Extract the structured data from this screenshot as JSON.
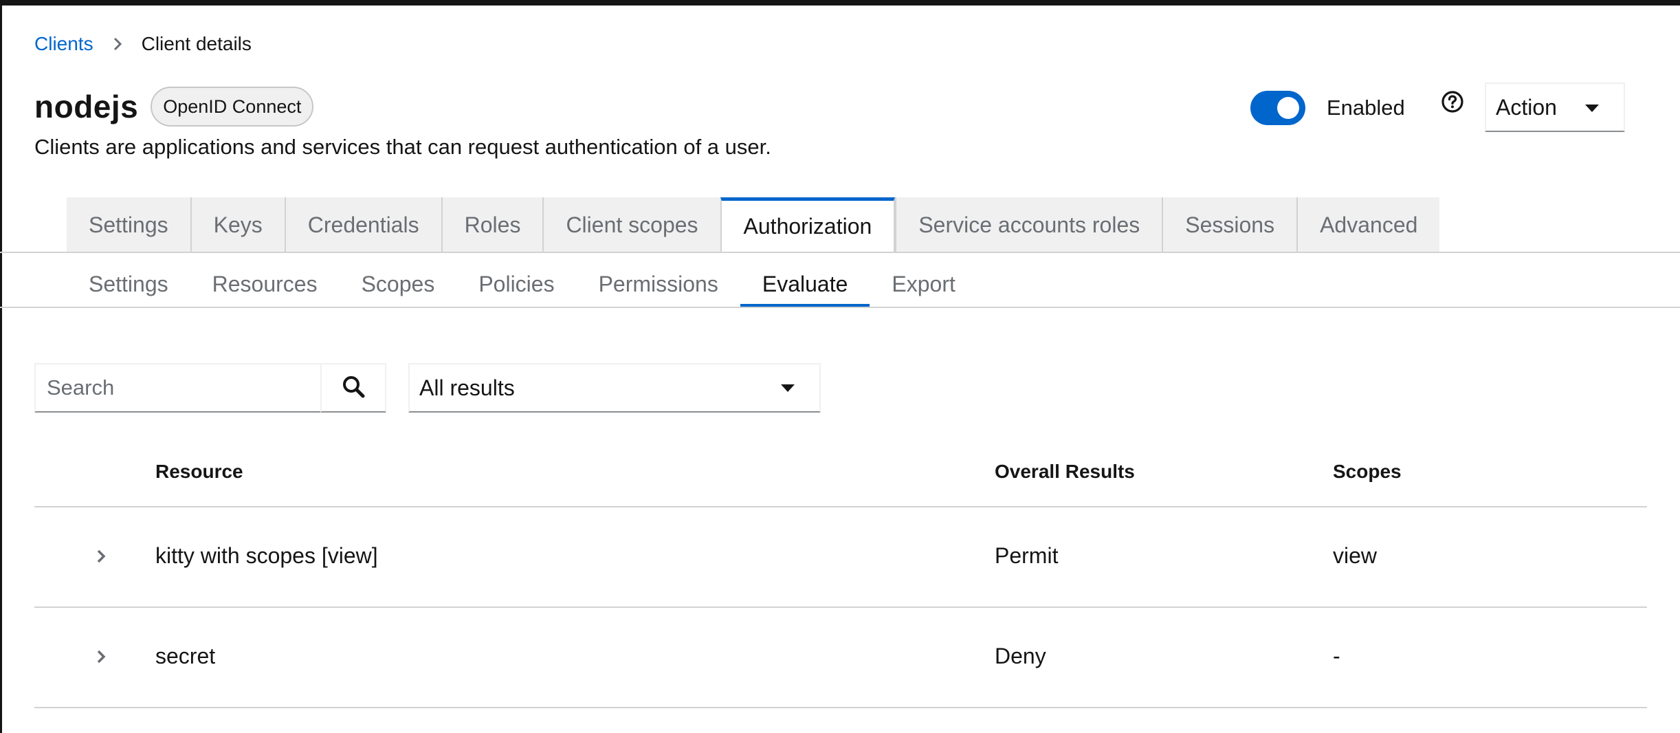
{
  "breadcrumb": {
    "parent": "Clients",
    "current": "Client details"
  },
  "header": {
    "title": "nodejs",
    "badge": "OpenID Connect",
    "subtitle": "Clients are applications and services that can request authentication of a user.",
    "enabled_label": "Enabled",
    "enabled": true,
    "action_label": "Action"
  },
  "main_tabs": [
    {
      "label": "Settings",
      "active": false
    },
    {
      "label": "Keys",
      "active": false
    },
    {
      "label": "Credentials",
      "active": false
    },
    {
      "label": "Roles",
      "active": false
    },
    {
      "label": "Client scopes",
      "active": false
    },
    {
      "label": "Authorization",
      "active": true
    },
    {
      "label": "Service accounts roles",
      "active": false
    },
    {
      "label": "Sessions",
      "active": false
    },
    {
      "label": "Advanced",
      "active": false
    }
  ],
  "sub_tabs": [
    {
      "label": "Settings",
      "active": false
    },
    {
      "label": "Resources",
      "active": false
    },
    {
      "label": "Scopes",
      "active": false
    },
    {
      "label": "Policies",
      "active": false
    },
    {
      "label": "Permissions",
      "active": false
    },
    {
      "label": "Evaluate",
      "active": true
    },
    {
      "label": "Export",
      "active": false
    }
  ],
  "toolbar": {
    "search_placeholder": "Search",
    "search_value": "",
    "filter_value": "All results"
  },
  "table": {
    "columns": {
      "resource": "Resource",
      "result": "Overall Results",
      "scopes": "Scopes"
    },
    "rows": [
      {
        "resource": "kitty with scopes [view]",
        "result": "Permit",
        "scopes": "view"
      },
      {
        "resource": "secret",
        "result": "Deny",
        "scopes": "-"
      }
    ]
  },
  "colors": {
    "accent": "#0066cc",
    "tab_bg": "#f0f0f0",
    "border": "#d2d2d2"
  },
  "icons": [
    "chevron-right-icon",
    "question-circle-icon",
    "caret-down-icon",
    "search-icon",
    "angle-right-icon"
  ]
}
